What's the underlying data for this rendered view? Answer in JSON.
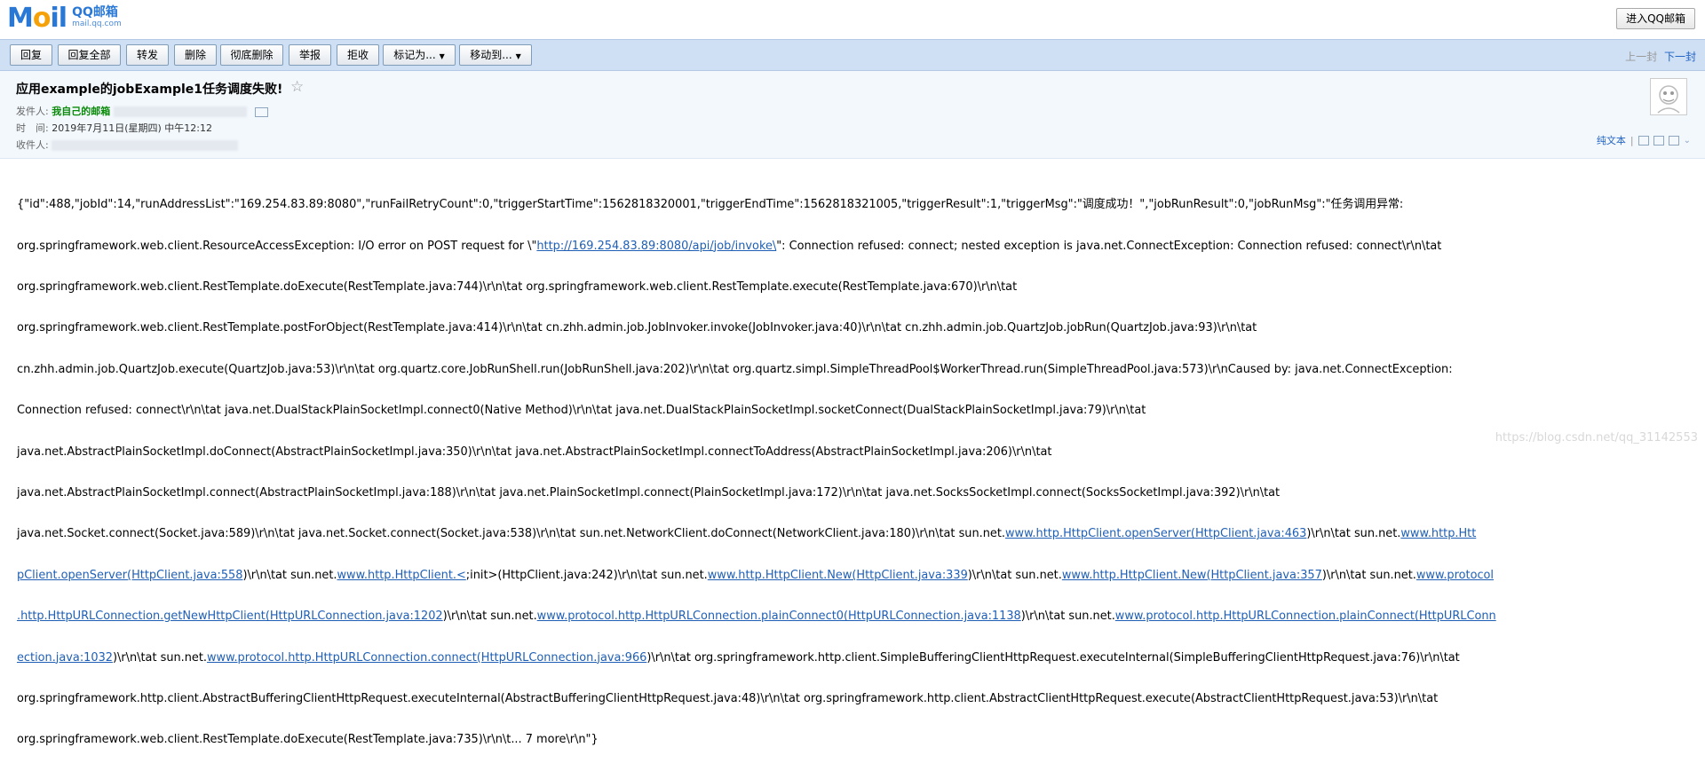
{
  "brand": {
    "logo_text_m": "M",
    "logo_text_o": "o",
    "logo_text_il": "il",
    "logo_qq": "QQ邮箱",
    "logo_domain": "mail.qq.com"
  },
  "top": {
    "enter_label": "进入QQ邮箱"
  },
  "toolbar": {
    "buttons": [
      "回复",
      "回复全部",
      "转发",
      "删除",
      "彻底删除",
      "举报",
      "拒收"
    ],
    "mark_label": "标记为...",
    "move_label": "移动到...",
    "prev_label": "上一封",
    "next_label": "下一封"
  },
  "header": {
    "subject": "应用example的jobExample1任务调度失败!",
    "star": "☆",
    "sender_label": "发件人:",
    "sender_name": "我自己的邮箱",
    "time_label": "时　间:",
    "time_value": "2019年7月11日(星期四) 中午12:12",
    "recipient_label": "收件人:",
    "plain_text_label": "纯文本",
    "sep": "|"
  },
  "body": {
    "line1": "{\"id\":488,\"jobId\":14,\"runAddressList\":\"169.254.83.89:8080\",\"runFailRetryCount\":0,\"triggerStartTime\":1562818320001,\"triggerEndTime\":1562818321005,\"triggerResult\":1,\"triggerMsg\":\"调度成功！\",\"jobRunResult\":0,\"jobRunMsg\":\"任务调用异常:",
    "line2a": "org.springframework.web.client.ResourceAccessException: I/O error on POST request for \\\"",
    "line2link": "http://169.254.83.89:8080/api/job/invoke\\",
    "line2b": "\": Connection refused: connect; nested exception is java.net.ConnectException: Connection refused: connect\\r\\n\\tat",
    "line3": "org.springframework.web.client.RestTemplate.doExecute(RestTemplate.java:744)\\r\\n\\tat org.springframework.web.client.RestTemplate.execute(RestTemplate.java:670)\\r\\n\\tat",
    "line4": "org.springframework.web.client.RestTemplate.postForObject(RestTemplate.java:414)\\r\\n\\tat cn.zhh.admin.job.JobInvoker.invoke(JobInvoker.java:40)\\r\\n\\tat cn.zhh.admin.job.QuartzJob.jobRun(QuartzJob.java:93)\\r\\n\\tat",
    "line5": "cn.zhh.admin.job.QuartzJob.execute(QuartzJob.java:53)\\r\\n\\tat org.quartz.core.JobRunShell.run(JobRunShell.java:202)\\r\\n\\tat org.quartz.simpl.SimpleThreadPool$WorkerThread.run(SimpleThreadPool.java:573)\\r\\nCaused by: java.net.ConnectException:",
    "line6": "Connection refused: connect\\r\\n\\tat java.net.DualStackPlainSocketImpl.connect0(Native Method)\\r\\n\\tat java.net.DualStackPlainSocketImpl.socketConnect(DualStackPlainSocketImpl.java:79)\\r\\n\\tat",
    "line7": "java.net.AbstractPlainSocketImpl.doConnect(AbstractPlainSocketImpl.java:350)\\r\\n\\tat java.net.AbstractPlainSocketImpl.connectToAddress(AbstractPlainSocketImpl.java:206)\\r\\n\\tat",
    "line8": "java.net.AbstractPlainSocketImpl.connect(AbstractPlainSocketImpl.java:188)\\r\\n\\tat java.net.PlainSocketImpl.connect(PlainSocketImpl.java:172)\\r\\n\\tat java.net.SocksSocketImpl.connect(SocksSocketImpl.java:392)\\r\\n\\tat",
    "line9a": "java.net.Socket.connect(Socket.java:589)\\r\\n\\tat java.net.Socket.connect(Socket.java:538)\\r\\n\\tat sun.net.NetworkClient.doConnect(NetworkClient.java:180)\\r\\n\\tat sun.net.",
    "line9link": "www.http.HttpClient.openServer(HttpClient.java:463",
    "line9b": ")\\r\\n\\tat sun.net.",
    "line9link2": "www.http.Htt",
    "line10link": "pClient.openServer(HttpClient.java:558",
    "line10a": ")\\r\\n\\tat sun.net.",
    "line10link2": "www.http.HttpClient.<",
    "line10b": ";init>(HttpClient.java:242)\\r\\n\\tat sun.net.",
    "line10link3": "www.http.HttpClient.New(HttpClient.java:339",
    "line10c": ")\\r\\n\\tat sun.net.",
    "line10link4": "www.http.HttpClient.New(HttpClient.java:357",
    "line10d": ")\\r\\n\\tat sun.net.",
    "line10link5": "www.protocol",
    "line11link": ".http.HttpURLConnection.getNewHttpClient(HttpURLConnection.java:1202",
    "line11a": ")\\r\\n\\tat sun.net.",
    "line11link2": "www.protocol.http.HttpURLConnection.plainConnect0(HttpURLConnection.java:1138",
    "line11b": ")\\r\\n\\tat sun.net.",
    "line11link3": "www.protocol.http.HttpURLConnection.plainConnect(HttpURLConn",
    "line12link": "ection.java:1032",
    "line12a": ")\\r\\n\\tat sun.net.",
    "line12link2": "www.protocol.http.HttpURLConnection.connect(HttpURLConnection.java:966",
    "line12b": ")\\r\\n\\tat org.springframework.http.client.SimpleBufferingClientHttpRequest.executeInternal(SimpleBufferingClientHttpRequest.java:76)\\r\\n\\tat",
    "line13": "org.springframework.http.client.AbstractBufferingClientHttpRequest.executeInternal(AbstractBufferingClientHttpRequest.java:48)\\r\\n\\tat org.springframework.http.client.AbstractClientHttpRequest.execute(AbstractClientHttpRequest.java:53)\\r\\n\\tat",
    "line14": "org.springframework.web.client.RestTemplate.doExecute(RestTemplate.java:735)\\r\\n\\t... 7 more\\r\\n\"}"
  },
  "watermark": "https://blog.csdn.net/qq_31142553"
}
